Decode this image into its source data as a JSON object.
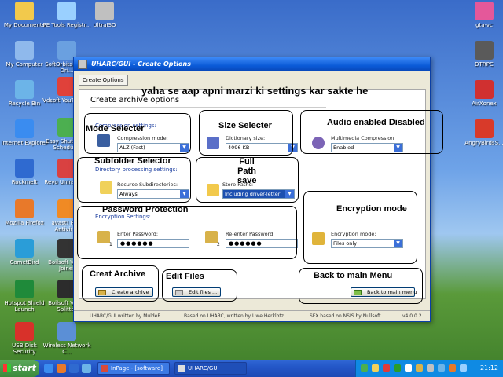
{
  "desktop_icons": [
    {
      "label": "My Documents",
      "color": "#f2c94c"
    },
    {
      "label": "PE Tools Registr...",
      "color": "#9ad0ff"
    },
    {
      "label": "UltraISO",
      "color": "#c0c0c0"
    },
    {
      "label": "My Computer",
      "color": "#8fb9ec"
    },
    {
      "label": "SoftOrbits Flash Dri...",
      "color": "#6aa0e0"
    },
    {
      "label": "Recycle Bin",
      "color": "#6cb4e8"
    },
    {
      "label": "Vdsoft YouTube ...",
      "color": "#e0413a"
    },
    {
      "label": "Internet Explorer",
      "color": "#3a8cf0"
    },
    {
      "label": "Easy Shutdown Scheduler",
      "color": "#4caf50"
    },
    {
      "label": "Rockmelt",
      "color": "#2f6ad0"
    },
    {
      "label": "Revo Uninstaller",
      "color": "#d94141"
    },
    {
      "label": "Mozilla Firefox",
      "color": "#e8792a"
    },
    {
      "label": "avast! Free Antivirus",
      "color": "#f08a24"
    },
    {
      "label": "CometBird",
      "color": "#2a9dd8"
    },
    {
      "label": "Boilsoft Video Joiner",
      "color": "#333333"
    },
    {
      "label": "Hotspot Shield Launch",
      "color": "#1f8a3a"
    },
    {
      "label": "Boilsoft Video Splitter",
      "color": "#2c2c2c"
    },
    {
      "label": "USB Disk Security",
      "color": "#d8312a"
    },
    {
      "label": "Wireless Network C...",
      "color": "#5b8fd6"
    },
    {
      "label": "gta-vc",
      "color": "#e4589a"
    },
    {
      "label": "DTRPC",
      "color": "#5a5a5a"
    },
    {
      "label": "AirXonex",
      "color": "#d03030"
    },
    {
      "label": "AngryBirdsS...",
      "color": "#d83a2a"
    }
  ],
  "window": {
    "title": "UHARC/GUI - Create Options",
    "tab": "Create Options",
    "panel_title": "Create archive options",
    "compression": {
      "section": "Compression settings:",
      "mode_label": "Compression mode:",
      "mode_value": "ALZ (Fast)",
      "dict_label": "Dictionary size:",
      "dict_value": "4096 KB",
      "multimedia_label": "Multimedia Compression:",
      "multimedia_value": "Enabled"
    },
    "directory": {
      "section": "Directory processing settings:",
      "recurse_label": "Recurse Subdirectories:",
      "recurse_value": "Always",
      "paths_label": "Store Paths:",
      "paths_value": "Including driver-letter"
    },
    "encryption": {
      "section": "Encryption Settings:",
      "enter_label": "Enter Password:",
      "enter_value": "●●●●●●",
      "reenter_label": "Re-enter Password:",
      "reenter_value": "●●●●●●",
      "num1": "1",
      "num2": "2",
      "mode_label": "Encryption mode:",
      "mode_value": "Files only"
    },
    "buttons": {
      "create": "Create archive",
      "edit": "Edit files ...",
      "back": "Back to main menu"
    },
    "status": {
      "left": "UHARC/GUI written by MuldeR",
      "mid": "Based on UHARC, written by Uwe Herklotz",
      "right": "SFX based on NSIS by Nullsoft",
      "version": "v4.0.0.2"
    }
  },
  "annotations": {
    "headline": "yaha se aap apni marzi ki settings kar sakte he",
    "mode": "Mode Selecter",
    "size": "Size Selecter",
    "audio": "Audio enabled Disabled",
    "subfolder": "Subfolder Selector",
    "fullpath": "Full Path save",
    "password": "Password Protection",
    "encmode": "Encryption mode",
    "create": "Creat Archive",
    "edit": "Edit Files",
    "back": "Back to main Menu"
  },
  "taskbar": {
    "start": "start",
    "tasks": [
      "InPage - [software]",
      "UHARC/GUI"
    ],
    "clock": "21:12"
  }
}
